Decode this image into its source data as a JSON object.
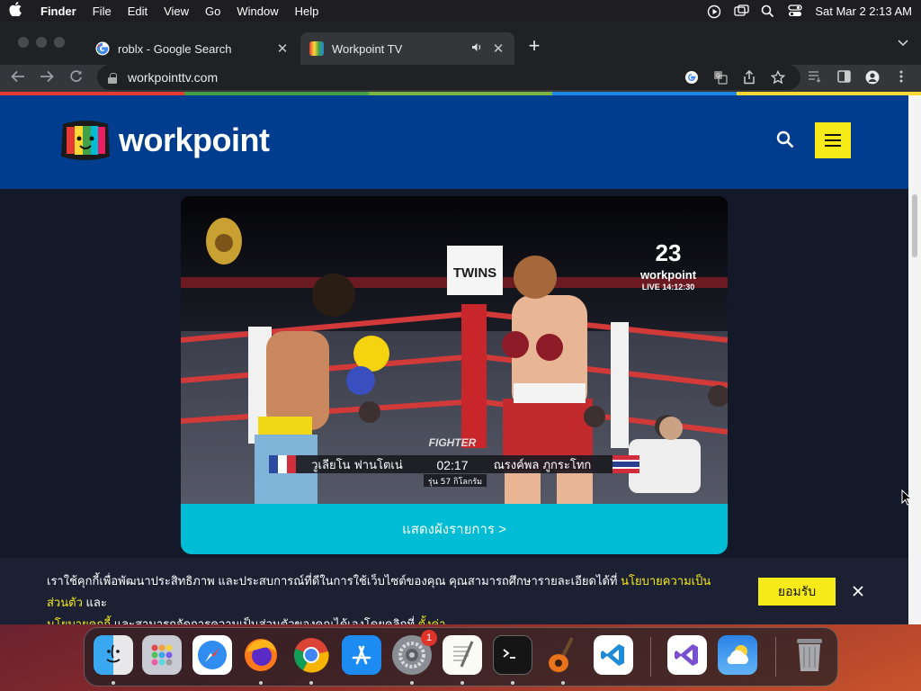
{
  "menubar": {
    "app_name": "Finder",
    "items": [
      "File",
      "Edit",
      "View",
      "Go",
      "Window",
      "Help"
    ],
    "datetime": "Sat Mar 2  2:13 AM"
  },
  "browser": {
    "tabs": [
      {
        "title": "roblx - Google Search",
        "active": false
      },
      {
        "title": "Workpoint TV",
        "active": true,
        "audio": true
      }
    ],
    "url": "workpointtv.com",
    "stripe_colors": [
      "#e53935",
      "#43a047",
      "#7cb342",
      "#1e88e5",
      "#fdd835"
    ]
  },
  "site": {
    "logo_text": "workpoint",
    "video": {
      "channel_number": "23",
      "channel_name": "workpoint",
      "live_label": "LIVE 14:12:30",
      "sponsor_banner": "TWINS",
      "fighter_left": "วูเลียโน ฟานโตเน่",
      "fighter_right": "ณรงค์พล ภูกระโทก",
      "round_timer": "02:17",
      "weight_class": "รุ่น 57 กิโลกรัม",
      "event_logo": "FIGHTER"
    },
    "schedule_button": "แสดงผังรายการ >",
    "cookie": {
      "text_1": "เราใช้คุกกี้เพื่อพัฒนาประสิทธิภาพ และประสบการณ์ที่ดีในการใช้เว็บไซต์ของคุณ คุณสามารถศึกษารายละเอียดได้ที่ ",
      "link_privacy": "นโยบายความเป็นส่วนตัว",
      "text_and": " และ",
      "link_cookie": "นโยบายคุกกี้",
      "text_2": " และสามารถจัดการความเป็นส่วนตัวของคุณได้เองโดยคลิกที่ ",
      "link_settings": "ตั้งค่า",
      "accept_label": "ยอมรับ"
    }
  },
  "dock": {
    "apps": [
      "Finder",
      "Launchpad",
      "Safari",
      "Firefox",
      "Chrome",
      "App Store",
      "System Preferences",
      "TextEdit",
      "Terminal",
      "GarageBand",
      "Visual Studio Code",
      "Visual Studio",
      "Weather",
      "Trash"
    ],
    "system_preferences_badge": "1"
  }
}
